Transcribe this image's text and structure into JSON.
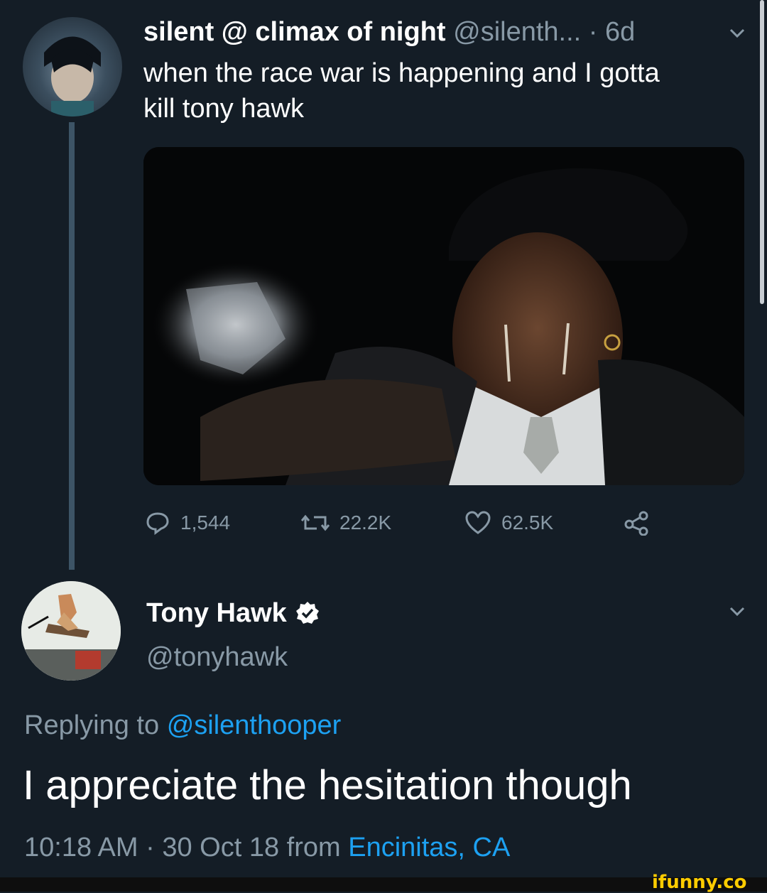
{
  "tweet1": {
    "display_name": "silent @ climax of night",
    "handle": "@silenth...",
    "separator": "·",
    "age": "6d",
    "text": "when the race war is happening and I gotta kill tony hawk",
    "stats": {
      "replies": "1,544",
      "retweets": "22.2K",
      "likes": "62.5K"
    },
    "media_description": "man in hat crying while pointing a gun"
  },
  "tweet2": {
    "display_name": "Tony Hawk",
    "handle": "@tonyhawk",
    "replying_prefix": "Replying to",
    "replying_handle": "@silenthooper",
    "text": "I appreciate the hesitation though",
    "timestamp": "10:18 AM · 30 Oct 18 from",
    "location": "Encinitas, CA"
  },
  "watermark": "ifunny.co",
  "colors": {
    "background": "#141d26",
    "muted": "#8899a6",
    "link": "#1da1f2",
    "watermark": "#ffcc00"
  }
}
